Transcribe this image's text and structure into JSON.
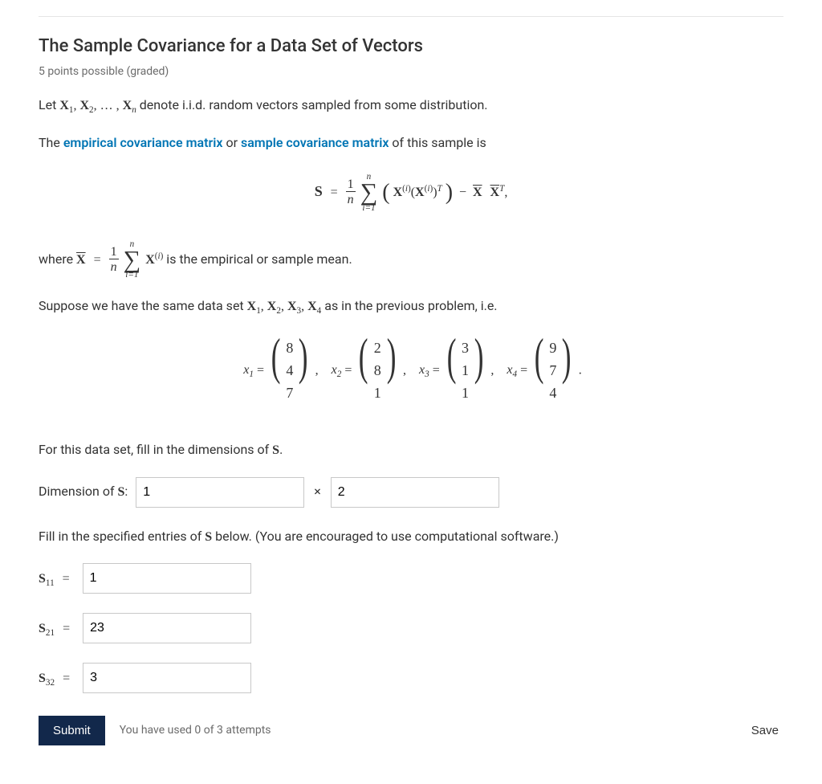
{
  "title": "The Sample Covariance for a Data Set of Vectors",
  "grading": "5 points possible (graded)",
  "p1_prefix": "Let ",
  "p1_suffix": " denote i.i.d. random vectors sampled from some distribution.",
  "p2_a": "The ",
  "p2_term1": "empirical covariance matrix",
  "p2_b": " or ",
  "p2_term2": "sample covariance matrix",
  "p2_c": " of this sample is",
  "where_prefix": "where ",
  "where_suffix": " is the empirical or sample mean.",
  "p3_a": "Suppose we have the same data set ",
  "p3_b": " as in the previous problem, i.e.",
  "vectors": {
    "x1": [
      "8",
      "4",
      "7"
    ],
    "x2": [
      "2",
      "8",
      "1"
    ],
    "x3": [
      "3",
      "1",
      "1"
    ],
    "x4": [
      "9",
      "7",
      "4"
    ]
  },
  "q_dim_intro_a": "For this data set, fill in the dimensions of ",
  "q_dim_intro_b": ".",
  "dim_label": "Dimension of ",
  "dim_sep": "×",
  "dim_value_rows": "1",
  "dim_value_cols": "2",
  "q_entries_a": "Fill in the specified entries of ",
  "q_entries_b": " below. (You are encouraged to use computational software.)",
  "entry_labels": {
    "s11": "11",
    "s21": "21",
    "s32": "32"
  },
  "entry_values": {
    "s11": "1",
    "s21": "23",
    "s32": "3"
  },
  "eq_sign": "=",
  "submit_label": "Submit",
  "attempts_text": "You have used 0 of 3 attempts",
  "save_label": "Save",
  "S": "S",
  "X": "X",
  "colon": ":",
  "xseq_comma": ", ",
  "xseq_dots": "… ,"
}
